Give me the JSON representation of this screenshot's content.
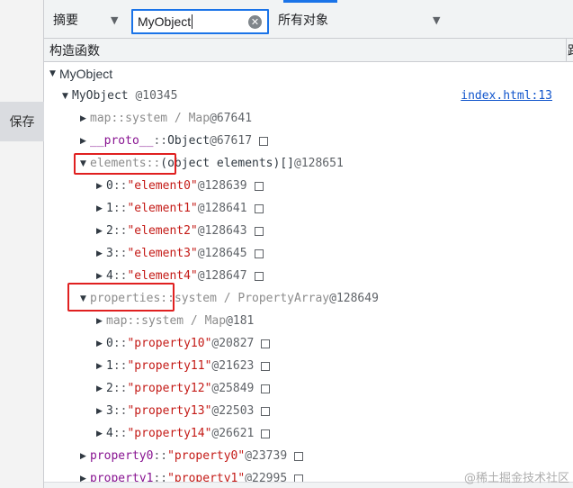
{
  "left_panel": {
    "save_label": "保存"
  },
  "toolbar": {
    "summary_label": "摘要",
    "search_value": "MyObject",
    "objects_label": "所有对象"
  },
  "header": {
    "constructor_label": "构造函数",
    "right_label": "距"
  },
  "tree": {
    "root": {
      "name": "MyObject"
    },
    "instance": {
      "name": "MyObject",
      "id": "@10345",
      "link": "index.html:13"
    },
    "map": {
      "key": "map",
      "sep": " :: ",
      "type": "system / Map",
      "id": " @67641"
    },
    "proto": {
      "key": "__proto__",
      "sep": " :: ",
      "type": "Object",
      "id": " @67617"
    },
    "elements": {
      "key": "elements",
      "sep": " :: ",
      "type": "(object elements)[]",
      "id": " @128651"
    },
    "elements_items": [
      {
        "index": "0",
        "sep": " :: ",
        "value": "\"element0\"",
        "id": " @128639"
      },
      {
        "index": "1",
        "sep": " :: ",
        "value": "\"element1\"",
        "id": " @128641"
      },
      {
        "index": "2",
        "sep": " :: ",
        "value": "\"element2\"",
        "id": " @128643"
      },
      {
        "index": "3",
        "sep": " :: ",
        "value": "\"element3\"",
        "id": " @128645"
      },
      {
        "index": "4",
        "sep": " :: ",
        "value": "\"element4\"",
        "id": " @128647"
      }
    ],
    "properties": {
      "key": "properties",
      "sep": " :: ",
      "type": "system / PropertyArray",
      "id": " @128649"
    },
    "properties_map": {
      "key": "map",
      "sep": " :: ",
      "type": "system / Map",
      "id": " @181"
    },
    "properties_items": [
      {
        "index": "0",
        "sep": " :: ",
        "value": "\"property10\"",
        "id": " @20827"
      },
      {
        "index": "1",
        "sep": " :: ",
        "value": "\"property11\"",
        "id": " @21623"
      },
      {
        "index": "2",
        "sep": " :: ",
        "value": "\"property12\"",
        "id": " @25849"
      },
      {
        "index": "3",
        "sep": " :: ",
        "value": "\"property13\"",
        "id": " @22503"
      },
      {
        "index": "4",
        "sep": " :: ",
        "value": "\"property14\"",
        "id": " @26621"
      }
    ],
    "property0": {
      "key": "property0",
      "sep": " :: ",
      "value": "\"property0\"",
      "id": " @23739"
    },
    "property1": {
      "key": "property1",
      "sep": " :: ",
      "value": "\"property1\"",
      "id": " @22995"
    }
  },
  "watermark": "@稀土掘金技术社区",
  "colors": {
    "highlight": "#e02020",
    "accent": "#1a73e8",
    "key": "#881391",
    "string": "#c41a16",
    "link": "#1155cc"
  }
}
